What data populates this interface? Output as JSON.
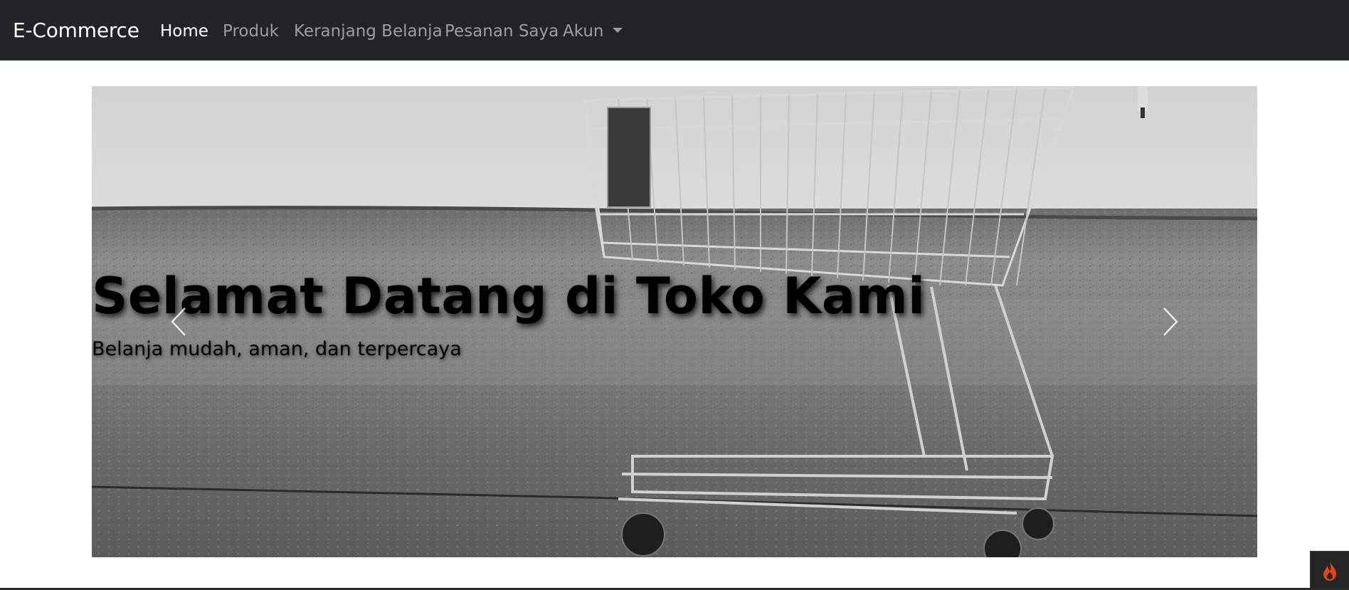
{
  "navbar": {
    "brand": "E-Commerce",
    "items": [
      {
        "label": "Home",
        "active": true
      },
      {
        "label": "Produk",
        "active": false
      },
      {
        "label": "Keranjang Belanja",
        "active": false
      },
      {
        "label": "Pesanan Saya",
        "active": false
      },
      {
        "label": "Akun",
        "active": false,
        "dropdown": true
      }
    ],
    "background": "#212529",
    "active_color": "#ffffff",
    "inactive_color": "rgba(255,255,255,0.55)"
  },
  "carousel": {
    "slide": {
      "image": "shopping-cart-photo",
      "title": "Selamat Datang di Toko Kami",
      "subtitle": "Belanja mudah, aman, dan terpercaya"
    },
    "prev_icon": "chevron-left-icon",
    "next_icon": "chevron-right-icon"
  },
  "debug_toolbar": {
    "icon": "flame-icon",
    "color": "#dd4814"
  }
}
